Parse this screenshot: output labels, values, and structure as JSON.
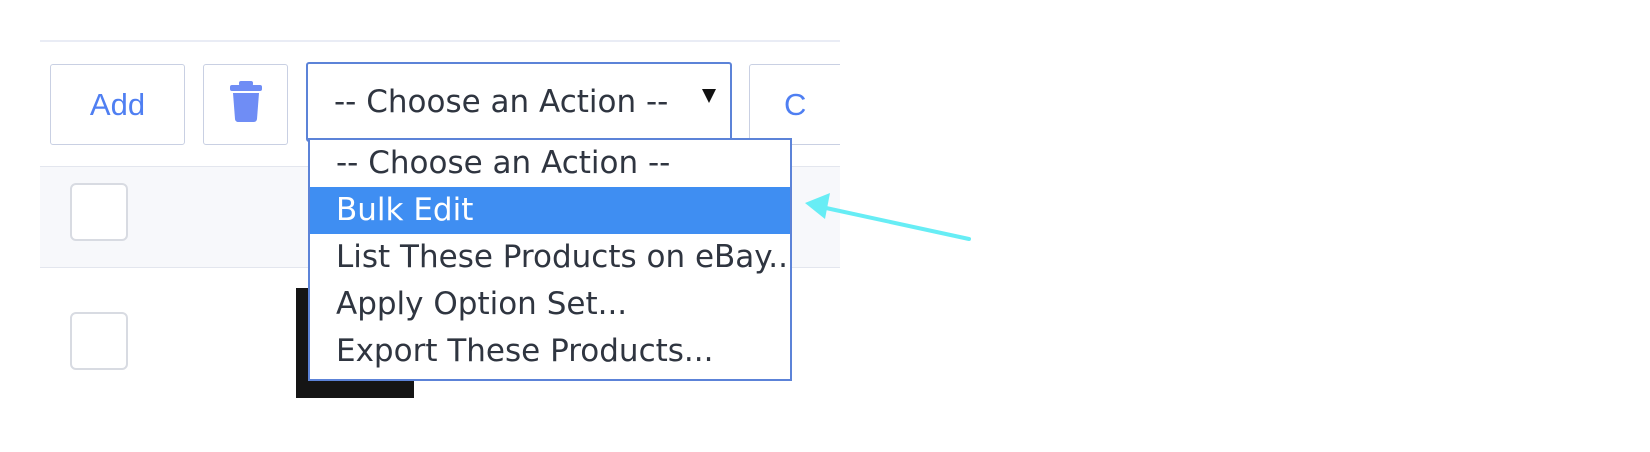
{
  "toolbar": {
    "add_label": "Add",
    "delete_icon": "trash-icon",
    "partial_button_label": "C"
  },
  "action_select": {
    "selected_value": "-- Choose an Action --",
    "options": [
      "-- Choose an Action --",
      "Bulk Edit",
      "List These Products on eBay...",
      "Apply Option Set...",
      "Export These Products..."
    ],
    "highlighted_index": 1
  },
  "colors": {
    "accent_blue": "#4f7ff2",
    "selected_option_blue": "#3f8ef2",
    "annotation_arrow": "#67edf5"
  }
}
